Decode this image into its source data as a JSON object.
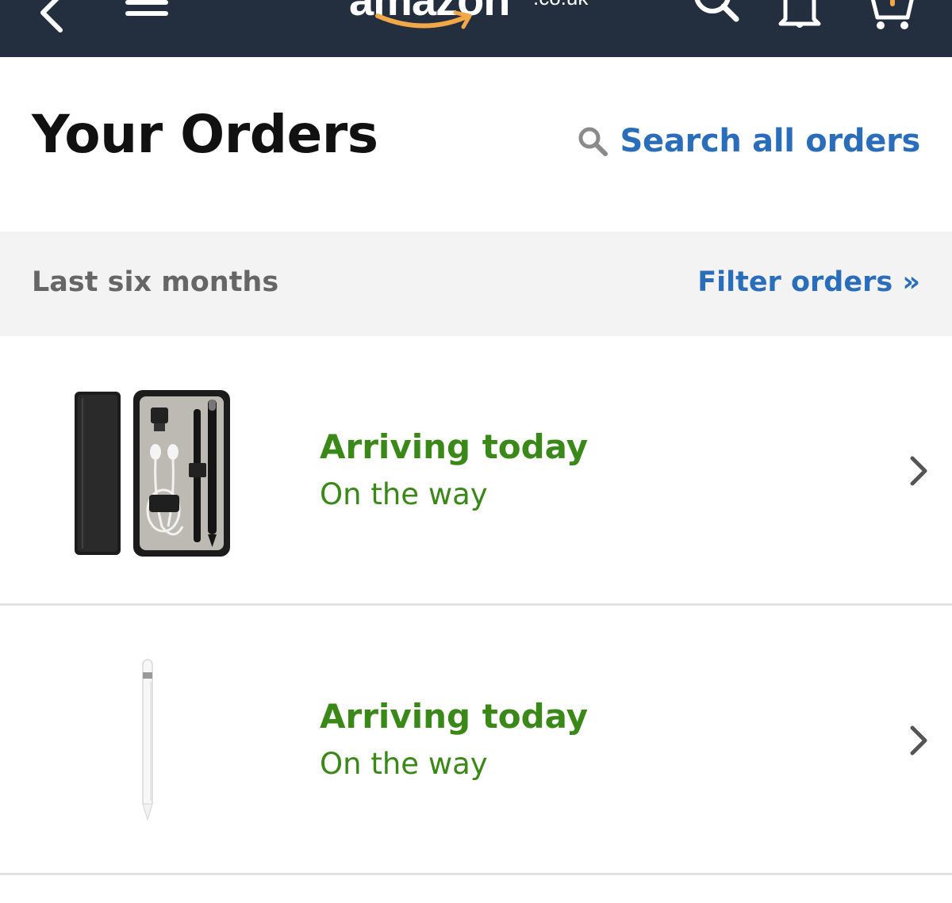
{
  "nav": {
    "logo_text": "amazon",
    "logo_tld": ".co.uk",
    "icons": [
      "back-icon",
      "menu-icon",
      "search-icon",
      "bell-icon",
      "cart-icon"
    ]
  },
  "header": {
    "title": "Your Orders",
    "search_label": "Search all orders"
  },
  "filter": {
    "period": "Last six months",
    "filter_label": "Filter orders »"
  },
  "orders": [
    {
      "status": "Arriving today",
      "substatus": "On the way",
      "image": "pencil-case-image"
    },
    {
      "status": "Arriving today",
      "substatus": "On the way",
      "image": "stylus-pencil-image"
    }
  ],
  "colors": {
    "nav_bg": "#232f3e",
    "link": "#2a6ebb",
    "status_green": "#398818",
    "band_bg": "#f3f3f3",
    "smile_orange": "#f3a847"
  }
}
